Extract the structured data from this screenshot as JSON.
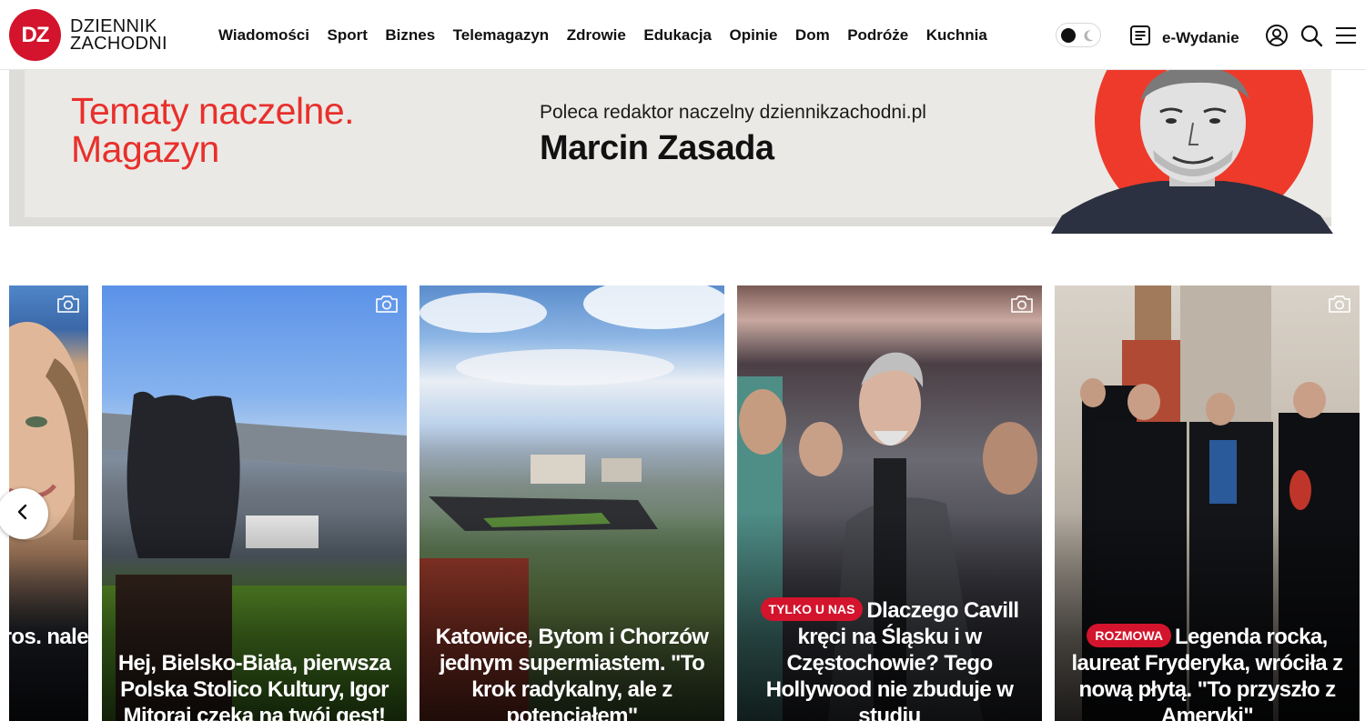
{
  "header": {
    "logo_badge": "DZ",
    "logo_line1": "DZIENNIK",
    "logo_line2": "ZACHODNI",
    "nav": [
      "Wiadomości",
      "Sport",
      "Biznes",
      "Telemagazyn",
      "Zdrowie",
      "Edukacja",
      "Opinie",
      "Dom",
      "Podróże",
      "Kuchnia"
    ],
    "edition_label": "e-Wydanie",
    "icons": [
      "theme-toggle-icon",
      "newspaper-icon",
      "user-icon",
      "search-icon",
      "menu-icon"
    ]
  },
  "banner": {
    "title_line1": "Tematy naczelne.",
    "title_line2": "Magazyn",
    "subtitle": "Poleca redaktor naczelny dziennikzachodni.pl",
    "name": "Marcin Zasada"
  },
  "carousel": {
    "cards": [
      {
        "badge": "",
        "title": "yła o arros. nale"
      },
      {
        "badge": "",
        "title": "Hej, Bielsko-Biała, pierwsza Polska Stolico Kultury, Igor Mitoraj czeka na twój gest!"
      },
      {
        "badge": "",
        "title": "Katowice, Bytom i Chorzów jednym supermiastem. \"To krok radykalny, ale z potencjałem\""
      },
      {
        "badge": "TYLKO U NAS",
        "title": "Dlaczego Cavill kręci na Śląsku i w Częstochowie? Tego Hollywood nie zbuduje w studiu"
      },
      {
        "badge": "ROZMOWA",
        "title": "Legenda rocka, laureat Fryderyka, wróciła z nową płytą. \"To przyszło z Ameryki\""
      }
    ]
  },
  "colors": {
    "brand_red": "#d3142c",
    "banner_title_red": "#e8302c",
    "banner_bg": "#ebe9e5"
  }
}
